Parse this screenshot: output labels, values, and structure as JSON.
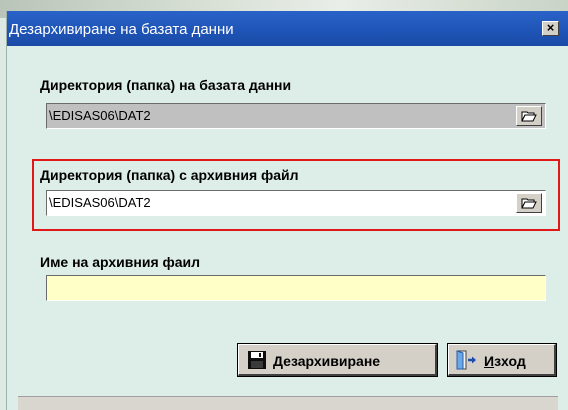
{
  "window": {
    "title": "Дезархивиране на базата данни",
    "close_glyph": "×"
  },
  "db_directory": {
    "label": "Директория (папка) на базата данни",
    "value": "\\EDISAS06\\DAT2",
    "browse_icon": "folder-open-icon"
  },
  "archive_directory": {
    "label": "Директория (папка) с архивния файл",
    "value": "\\EDISAS06\\DAT2",
    "browse_icon": "folder-open-icon"
  },
  "archive_file": {
    "label": "Име на архивния фаил",
    "value": ""
  },
  "buttons": {
    "restore": {
      "mnemonic": "Д",
      "rest": "езархивиране",
      "icon": "floppy-disk-icon"
    },
    "exit": {
      "mnemonic": "И",
      "rest": "зход",
      "icon": "exit-door-icon"
    }
  },
  "colors": {
    "titlebar": "#1f55b7",
    "dialog_bg": "#ddeee9",
    "disabled_field": "#c0c0c0",
    "active_field": "#ffffff",
    "empty_field": "#ffffc8",
    "highlight": "#e01818"
  }
}
